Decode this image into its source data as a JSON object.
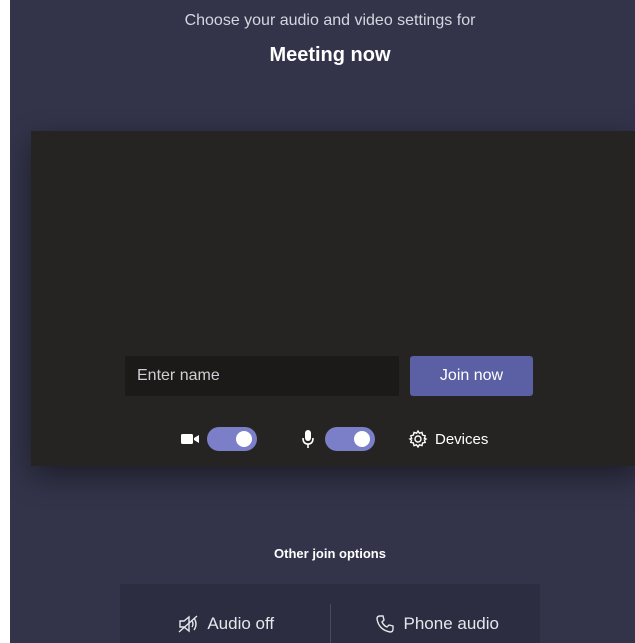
{
  "header": {
    "subtitle": "Choose your audio and video settings for",
    "title": "Meeting now"
  },
  "preview": {
    "name_placeholder": "Enter name",
    "join_label": "Join now",
    "camera_toggle_on": true,
    "mic_toggle_on": true,
    "devices_label": "Devices"
  },
  "other_options": {
    "label": "Other join options",
    "audio_off_label": "Audio off",
    "phone_audio_label": "Phone audio"
  },
  "colors": {
    "background": "#33344a",
    "preview": "#252423",
    "accent": "#5b5fa4",
    "toggle": "#7b7fc8"
  },
  "icons": {
    "camera": "video-camera-icon",
    "mic": "microphone-icon",
    "devices": "gear-icon",
    "audio_off": "speaker-off-icon",
    "phone": "phone-icon"
  }
}
